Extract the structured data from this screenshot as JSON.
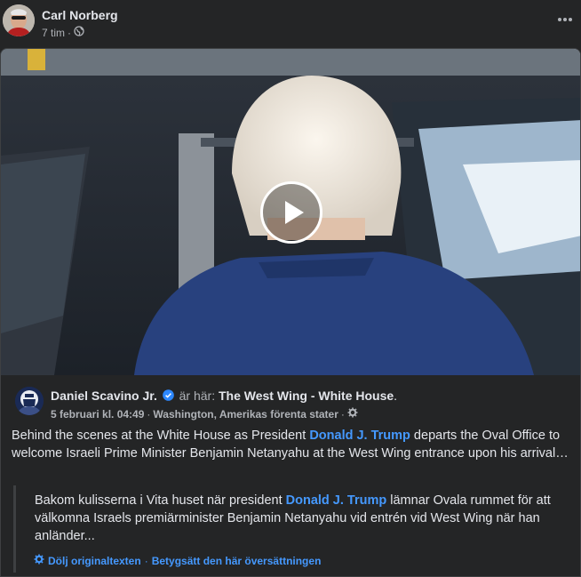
{
  "post": {
    "author": "Carl Norberg",
    "time": "7 tim",
    "separator": "·",
    "privacy_icon": "globe-icon",
    "more_icon": "more-horizontal-icon"
  },
  "shared": {
    "video": {
      "play_icon": "play-icon"
    },
    "source": {
      "name": "Daniel Scavino Jr.",
      "verified_icon": "verified-badge-icon",
      "is_at": "är här:",
      "place": "The West Wing - White House",
      "period": ".",
      "date": "5 februari kl. 04:49",
      "location": "Washington, Amerikas förenta stater",
      "sep": "·",
      "audience_icon": "gear-icon"
    },
    "text": {
      "before": "Behind the scenes at the White House as President ",
      "mention": "Donald J. Trump",
      "after": " departs the Oval Office to welcome Israeli Prime Minister Benjamin Netanyahu at the West Wing entrance upon his arrival…"
    },
    "translation": {
      "before": "Bakom kulisserna i Vita huset när president ",
      "mention": "Donald J. Trump",
      "after": " lämnar Ovala rummet för att välkomna Israels premiärminister Benjamin Netanyahu vid entrén vid West Wing när han anländer...",
      "settings_icon": "gear-icon",
      "hide_original": "Dölj originaltexten",
      "sep": "·",
      "rate": "Betygsätt den här översättningen"
    }
  },
  "colors": {
    "background": "#242526",
    "text": "#e4e6eb",
    "muted": "#b0b3b8",
    "link": "#4599ff",
    "verified": "#2d88ff"
  }
}
